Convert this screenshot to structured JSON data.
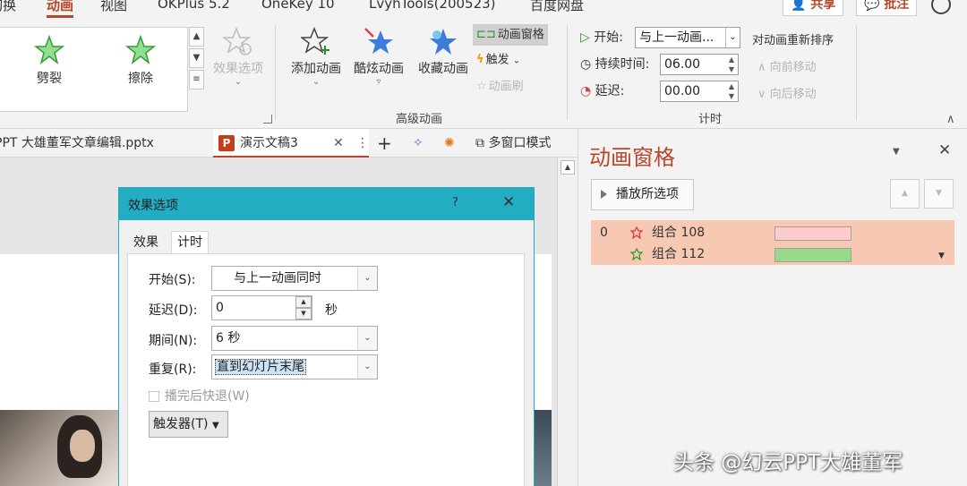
{
  "ribbon_tabs": [
    "切换",
    "动画",
    "视图",
    "OKPlus 5.2",
    "OneKey 10",
    "LvyhTools(200523)",
    "百度网盘"
  ],
  "share_label": "共享",
  "comment_label": "批注",
  "gallery": {
    "items": [
      {
        "label": "劈裂"
      },
      {
        "label": "擦除"
      }
    ],
    "effect_options_label": "效果选项"
  },
  "advanced": {
    "add_animation": "添加动画",
    "cool_animation": "酷炫动画",
    "favorite_animation": "收藏动画",
    "animation_pane": "动画窗格",
    "trigger": "触发",
    "animation_painter": "动画刷",
    "group_label": "高级动画"
  },
  "timing": {
    "start_label": "开始:",
    "start_value": "与上一动画...",
    "duration_label": "持续时间:",
    "duration_value": "06.00",
    "delay_label": "延迟:",
    "delay_value": "00.00",
    "reorder_label": "对动画重新排序",
    "move_earlier": "向前移动",
    "move_later": "向后移动",
    "group_label": "计时"
  },
  "doc_tabs": {
    "file1": "PPT 大雄董军文章编辑.pptx",
    "file2": "演示文稿3",
    "multi_window": "多窗口模式"
  },
  "dialog": {
    "title": "效果选项",
    "help": "?",
    "tabs": [
      "效果",
      "计时"
    ],
    "start_label": "开始(S):",
    "start_value": "与上一动画同时",
    "delay_label": "延迟(D):",
    "delay_value": "0",
    "delay_unit": "秒",
    "duration_label": "期间(N):",
    "duration_value": "6 秒",
    "repeat_label": "重复(R):",
    "repeat_value": "直到幻灯片末尾",
    "rewind_label": "播完后快退(W)",
    "trigger_label": "触发器(T)"
  },
  "anim_pane": {
    "title": "动画窗格",
    "play_selected": "播放所选项",
    "items": [
      {
        "index": "0",
        "name": "组合 108",
        "bar_color": "#ffcccc"
      },
      {
        "index": "",
        "name": "组合 112",
        "bar_color": "#99d98c"
      }
    ]
  },
  "watermark": "头条 @幻云PPT大雄董军",
  "colors": {
    "accent": "#b7472a",
    "dialog_title": "#22adc3",
    "selection": "#f7c9b3"
  }
}
